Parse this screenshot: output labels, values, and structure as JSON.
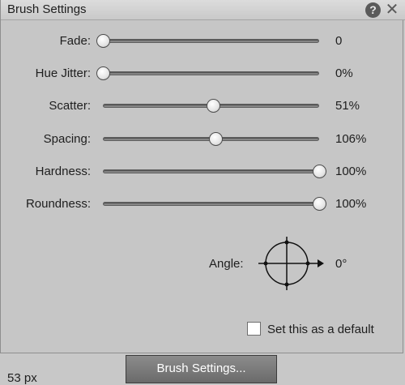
{
  "window": {
    "title": "Brush Settings",
    "help_icon": "help-icon",
    "close_icon": "close-icon"
  },
  "sliders": [
    {
      "label": "Fade:",
      "value": "0",
      "level": 0
    },
    {
      "label": "Hue Jitter:",
      "value": "0%",
      "level": 0
    },
    {
      "label": "Scatter:",
      "value": "51%",
      "level": 0.51
    },
    {
      "label": "Spacing:",
      "value": "106%",
      "level": 0.52
    },
    {
      "label": "Hardness:",
      "value": "100%",
      "level": 1.0
    },
    {
      "label": "Roundness:",
      "value": "100%",
      "level": 1.0
    }
  ],
  "angle": {
    "label": "Angle:",
    "value": "0°",
    "degrees": 0
  },
  "default_option": {
    "label": "Set this as a default",
    "checked": false
  },
  "footer": {
    "button_label": "Brush Settings...",
    "size_readout": "53 px"
  }
}
